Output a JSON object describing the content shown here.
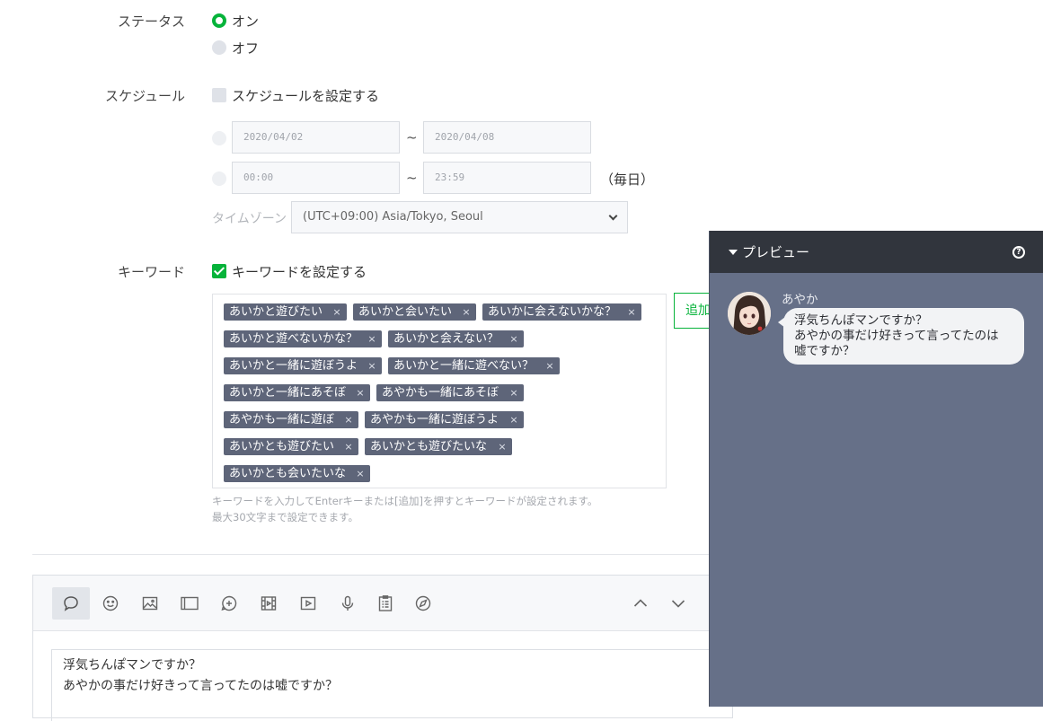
{
  "status": {
    "label": "ステータス",
    "on_label": "オン",
    "off_label": "オフ"
  },
  "schedule": {
    "label": "スケジュール",
    "checkbox_label": "スケジュールを設定する",
    "start_date": "2020/04/02",
    "end_date": "2020/04/08",
    "start_time": "00:00",
    "end_time": "23:59",
    "tilde": "~",
    "daily_label": "（毎日）",
    "timezone_label": "タイムゾーン :",
    "timezone_value": "(UTC+09:00) Asia/Tokyo, Seoul"
  },
  "keyword": {
    "label": "キーワード",
    "checkbox_label": "キーワードを設定する",
    "tags": [
      "あいかと遊びたい",
      "あいかと会いたい",
      "あいかに会えないかな？",
      "あいかと遊べないかな？",
      "あいかと会えない？",
      "あいかと一緒に遊ぼうよ",
      "あいかと一緒に遊べない？",
      "あいかと一緒にあそぼ",
      "あやかも一緒にあそぼ",
      "あやかも一緒に遊ぼ",
      "あやかも一緒に遊ぼうよ",
      "あいかとも遊びたい",
      "あいかとも遊びたいな",
      "あいかとも会いたいな"
    ],
    "remove_symbol": "×",
    "add_button": "追加",
    "hint_line1": "キーワードを入力してEnterキーまたは[追加]を押すとキーワードが設定されます。",
    "hint_line2": "最大30文字まで設定できます。"
  },
  "editor": {
    "toolbar_icons": [
      "speech-bubble-icon",
      "emoji-icon",
      "image-icon",
      "card-icon",
      "sticker-icon",
      "film-icon",
      "video-icon",
      "mic-icon",
      "survey-icon",
      "compass-icon"
    ],
    "message_line1": "浮気ちんぽマンですか？",
    "message_line2": "あやかの事だけ好きって言ってたのは嘘ですか？"
  },
  "preview": {
    "title": "プレビュー",
    "help_symbol": "?",
    "sender_name": "あやか",
    "message_line1": "浮気ちんぽマンですか？",
    "message_line2": "あやかの事だけ好きって言ってたのは",
    "message_line3": "嘘ですか？"
  },
  "colors": {
    "accent": "#06b33a",
    "tag": "#5e6579",
    "preview_bg": "#667088",
    "preview_header": "#31353d"
  }
}
